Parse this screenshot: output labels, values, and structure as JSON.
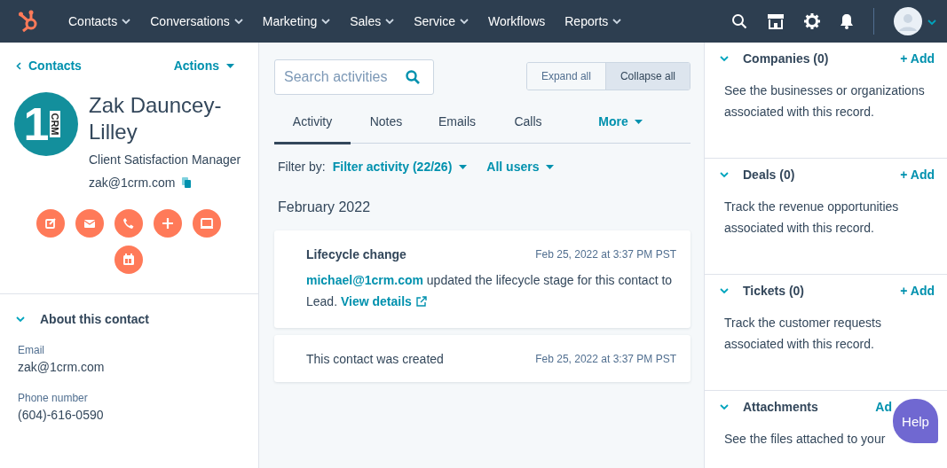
{
  "nav": {
    "items": [
      {
        "label": "Contacts",
        "caret": true
      },
      {
        "label": "Conversations",
        "caret": true
      },
      {
        "label": "Marketing",
        "caret": true
      },
      {
        "label": "Sales",
        "caret": true
      },
      {
        "label": "Service",
        "caret": true
      },
      {
        "label": "Workflows",
        "caret": false
      },
      {
        "label": "Reports",
        "caret": true
      }
    ]
  },
  "contact": {
    "back_link": "Contacts",
    "actions": "Actions",
    "logo": {
      "numeral": "1",
      "letters": "CRM"
    },
    "name": "Zak Dauncey-Lilley",
    "job_title": "Client Satisfaction Manager",
    "email": "zak@1crm.com"
  },
  "about": {
    "title": "About this contact",
    "expanded": true,
    "fields": [
      {
        "label": "Email",
        "value": "zak@1crm.com"
      },
      {
        "label": "Phone number",
        "value": "(604)-616-0590"
      }
    ]
  },
  "timeline": {
    "search": {
      "placeholder": "Search activities"
    },
    "toggles": [
      {
        "label": "Expand all",
        "selected": false
      },
      {
        "label": "Collapse all",
        "selected": true
      }
    ],
    "tabs": [
      {
        "label": "Activity",
        "selected": true,
        "kind": "tab"
      },
      {
        "label": "Notes",
        "selected": false,
        "kind": "tab"
      },
      {
        "label": "Emails",
        "selected": false,
        "kind": "tab"
      },
      {
        "label": "Calls",
        "selected": false,
        "kind": "tab"
      },
      {
        "label": "More",
        "selected": false,
        "kind": "dropdown"
      }
    ],
    "filter_label": "Filter by:",
    "filters": [
      "Filter activity (22/26)",
      "All users"
    ],
    "month": "February 2022",
    "activities": [
      {
        "kind": "lifecycle",
        "title": "Lifecycle change",
        "time": "Feb 25, 2022 at 3:37 PM PST",
        "actor": "michael@1crm.com",
        "text": "updated the lifecycle stage for this contact to Lead.",
        "link": "View details"
      },
      {
        "kind": "created",
        "title": "This contact was created",
        "time": "Feb 25, 2022 at 3:37 PM PST"
      }
    ]
  },
  "sections": [
    {
      "title": "Companies (0)",
      "expanded": true,
      "add": "+ Add",
      "description": "See the businesses or organizations associated with this record."
    },
    {
      "title": "Deals (0)",
      "expanded": true,
      "add": "+ Add",
      "description": "Track the revenue opportunities associated with this record."
    },
    {
      "title": "Tickets (0)",
      "expanded": true,
      "add": "+ Add",
      "description": "Track the customer requests associated with this record."
    },
    {
      "title": "Attachments",
      "expanded": true,
      "add": "Ad",
      "description": "See the files attached to your"
    }
  ],
  "help": "Help"
}
